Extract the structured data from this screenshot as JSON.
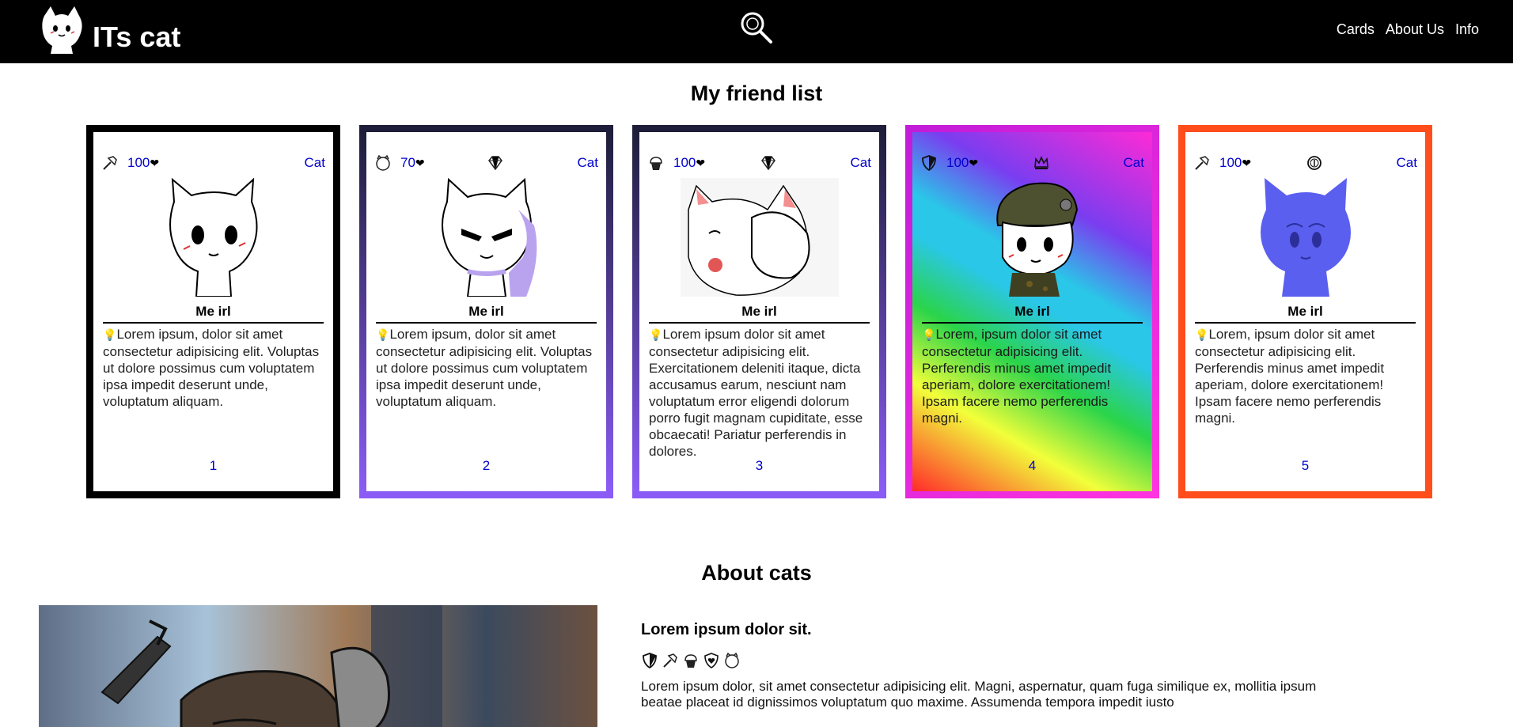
{
  "header": {
    "brand": "ITs cat",
    "nav": [
      "Cards",
      "About Us",
      "Info"
    ]
  },
  "friends": {
    "title": "My friend list",
    "cards": [
      {
        "hp": "100",
        "type_icon": "hammer-icon",
        "rarity_icon": "",
        "category": "Cat",
        "name": "Me irl",
        "text": "Lorem ipsum, dolor sit amet consectetur adipisicing elit. Voluptas ut dolore possimus cum voluptatem ipsa impedit deserunt unde, voluptatum aliquam.",
        "number": "1",
        "border_color": "#000000"
      },
      {
        "hp": "70",
        "type_icon": "cat-face-icon",
        "rarity_icon": "diamond-icon",
        "category": "Cat",
        "name": "Me irl",
        "text": "Lorem ipsum, dolor sit amet consectetur adipisicing elit. Voluptas ut dolore possimus cum voluptatem ipsa impedit deserunt unde, voluptatum aliquam.",
        "number": "2",
        "border_color": "#8a5cf5"
      },
      {
        "hp": "100",
        "type_icon": "cupcake-icon",
        "rarity_icon": "diamond-icon",
        "category": "Cat",
        "name": "Me irl",
        "text": "Lorem ipsum dolor sit amet consectetur adipisicing elit. Exercitationem deleniti itaque, dicta accusamus earum, nesciunt nam voluptatum error eligendi dolorum porro fugit magnam cupiditate, esse obcaecati! Pariatur perferendis in dolores.",
        "number": "3",
        "border_color": "#8a5cf5"
      },
      {
        "hp": "100",
        "type_icon": "shield-icon",
        "rarity_icon": "crown-icon",
        "category": "Cat",
        "name": "Me irl",
        "text": "Lorem, ipsum dolor sit amet consectetur adipisicing elit. Perferendis minus amet impedit aperiam, dolore exercitationem! Ipsam facere nemo perferendis magni.",
        "number": "4",
        "border_color": "#e21ce0"
      },
      {
        "hp": "100",
        "type_icon": "hammer-icon",
        "rarity_icon": "coin-icon",
        "category": "Cat",
        "name": "Me irl",
        "text": "Lorem, ipsum dolor sit amet consectetur adipisicing elit. Perferendis minus amet impedit aperiam, dolore exercitationem! Ipsam facere nemo perferendis magni.",
        "number": "5",
        "border_color": "#ff4d1c"
      }
    ]
  },
  "about": {
    "title": "About cats",
    "heading": "Lorem ipsum dolor sit.",
    "icons": [
      "shield-icon",
      "hammer-icon",
      "cupcake-icon",
      "heart-shield-icon",
      "cat-face-icon"
    ],
    "text": "Lorem ipsum dolor, sit amet consectetur adipisicing elit. Magni, aspernatur, quam fuga similique ex, mollitia ipsum beataе placeat id dignissimos voluptatum quo maxime. Assumenda tempora impedit iusto"
  }
}
